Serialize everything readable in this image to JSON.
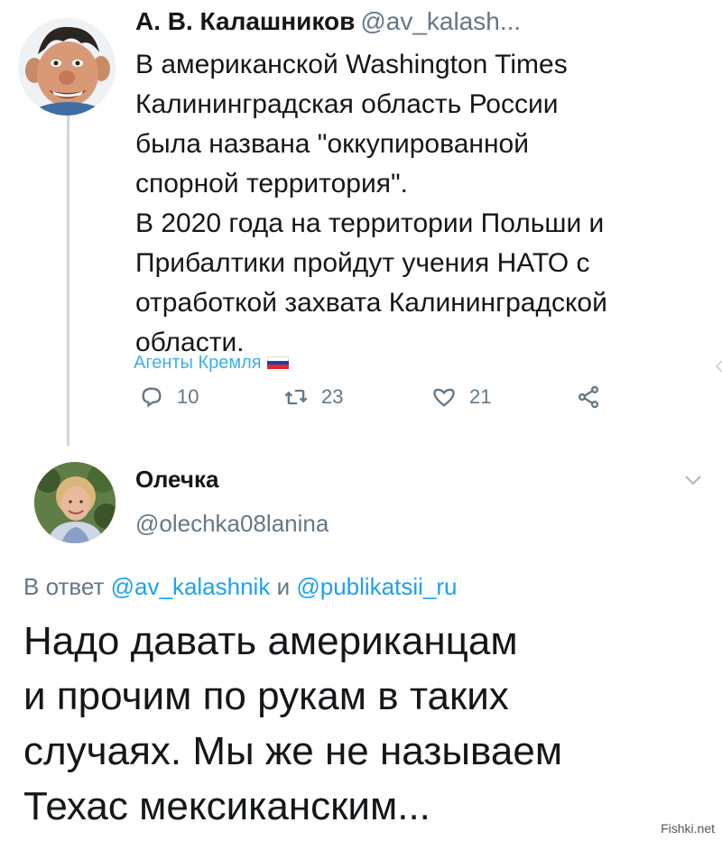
{
  "tweet1": {
    "author_name": "А. В. Калашников",
    "author_handle": "@av_kalash...",
    "lines": [
      "В американской Washington Times",
      "Калининградская область России",
      "была названа \"оккупированной",
      "спорной территория\".",
      "В 2020 года на территории Польши и",
      "Прибалтики пройдут учения НАТО с",
      "отработкой захвата Калининградской",
      "области."
    ],
    "replies": "10",
    "retweets": "23",
    "likes": "21",
    "icons": [
      "reply-icon",
      "retweet-icon",
      "like-icon",
      "share-icon"
    ]
  },
  "watermark": {
    "text": "Агенты Кремля",
    "flag_colors": [
      "#ffffff",
      "#1c3fa8",
      "#e3262c"
    ]
  },
  "tweet2": {
    "author_name": "Олечка",
    "author_handle": "@olechka08lanina",
    "reply_prefix": "В ответ",
    "reply_user1": "@av_kalashnik",
    "reply_conj": "и",
    "reply_user2": "@publikatsii_ru",
    "lines": [
      "Надо давать американцам",
      "и прочим по рукам в таких",
      "случаях. Мы же не называем",
      "Техас мексиканским..."
    ]
  },
  "site_mark": "Fishki.net",
  "colors": {
    "text": "#14171a",
    "secondary": "#657786",
    "link": "#1da1f2",
    "thread_line": "#ccd6dd",
    "watermark": "#3fb0e6"
  }
}
